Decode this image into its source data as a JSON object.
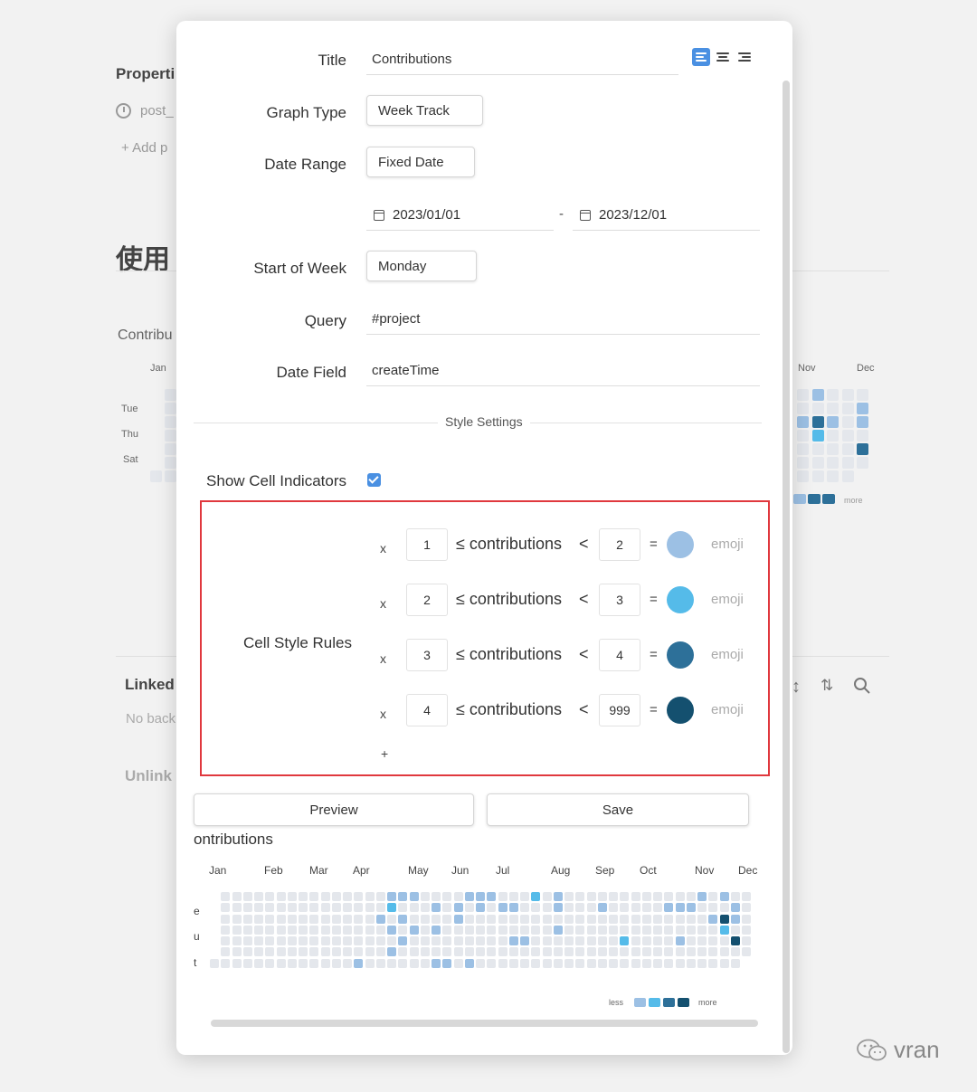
{
  "background": {
    "properties_heading": "Properti",
    "post_field": "post_",
    "add_property": "+ Add p",
    "section_heading": "使用",
    "contrib_heading": "Contribu",
    "months_left": "Jan",
    "months_right": [
      "Nov",
      "Dec"
    ],
    "day_labels": [
      "Tue",
      "Thu",
      "Sat"
    ],
    "legend_more": "more",
    "linked_heading": "Linked",
    "no_backlinks": "No back",
    "unlinked_heading": "Unlink",
    "brand": "vran"
  },
  "modal": {
    "title_label": "Title",
    "title_value": "Contributions",
    "graph_type_label": "Graph Type",
    "graph_type_value": "Week Track",
    "date_range_label": "Date Range",
    "date_range_value": "Fixed Date",
    "start_date": "2023/01/01",
    "range_sep": "-",
    "end_date": "2023/12/01",
    "start_of_week_label": "Start of Week",
    "start_of_week_value": "Monday",
    "query_label": "Query",
    "query_value": "#project",
    "date_field_label": "Date Field",
    "date_field_value": "createTime",
    "style_settings": "Style Settings",
    "show_cell_indicators_label": "Show Cell Indicators",
    "show_cell_indicators": true,
    "cell_style_rules_label": "Cell Style Rules",
    "rules": [
      {
        "remove": "x",
        "min": "1",
        "le": "≤",
        "field": "contributions",
        "lt": "<",
        "max": "2",
        "eq": "=",
        "color": "#9cc0e4",
        "emoji": "emoji"
      },
      {
        "remove": "x",
        "min": "2",
        "le": "≤",
        "field": "contributions",
        "lt": "<",
        "max": "3",
        "eq": "=",
        "color": "#55bbe9",
        "emoji": "emoji"
      },
      {
        "remove": "x",
        "min": "3",
        "le": "≤",
        "field": "contributions",
        "lt": "<",
        "max": "4",
        "eq": "=",
        "color": "#2d7099",
        "emoji": "emoji"
      },
      {
        "remove": "x",
        "min": "4",
        "le": "≤",
        "field": "contributions",
        "lt": "<",
        "max": "999",
        "eq": "=",
        "color": "#14506f",
        "emoji": "emoji"
      }
    ],
    "add_rule": "+",
    "preview_button": "Preview",
    "save_button": "Save"
  },
  "preview": {
    "title": "ontributions",
    "months": [
      "Jan",
      "Feb",
      "Mar",
      "Apr",
      "May",
      "Jun",
      "Jul",
      "Aug",
      "Sep",
      "Oct",
      "Nov",
      "Dec"
    ],
    "day_labels": [
      "e",
      "u",
      "t"
    ],
    "legend_less": "less",
    "legend_more": "more",
    "colors": {
      "empty": "#e4e7ec",
      "l1": "#9cc0e4",
      "l2": "#55bbe9",
      "l3": "#2d7099",
      "l4": "#14506f"
    }
  }
}
